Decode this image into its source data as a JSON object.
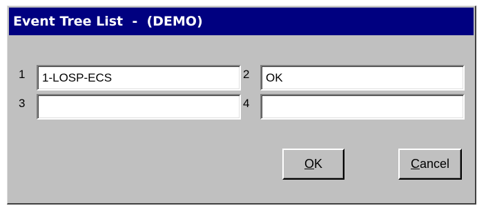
{
  "window": {
    "title": "Event Tree List  -  (DEMO)"
  },
  "fields": [
    {
      "number": "1",
      "value": "1-LOSP-ECS"
    },
    {
      "number": "2",
      "value": "OK"
    },
    {
      "number": "3",
      "value": ""
    },
    {
      "number": "4",
      "value": ""
    }
  ],
  "buttons": {
    "ok": {
      "mnemonic": "O",
      "rest": "K"
    },
    "cancel": {
      "mnemonic": "C",
      "rest": "ancel"
    }
  }
}
